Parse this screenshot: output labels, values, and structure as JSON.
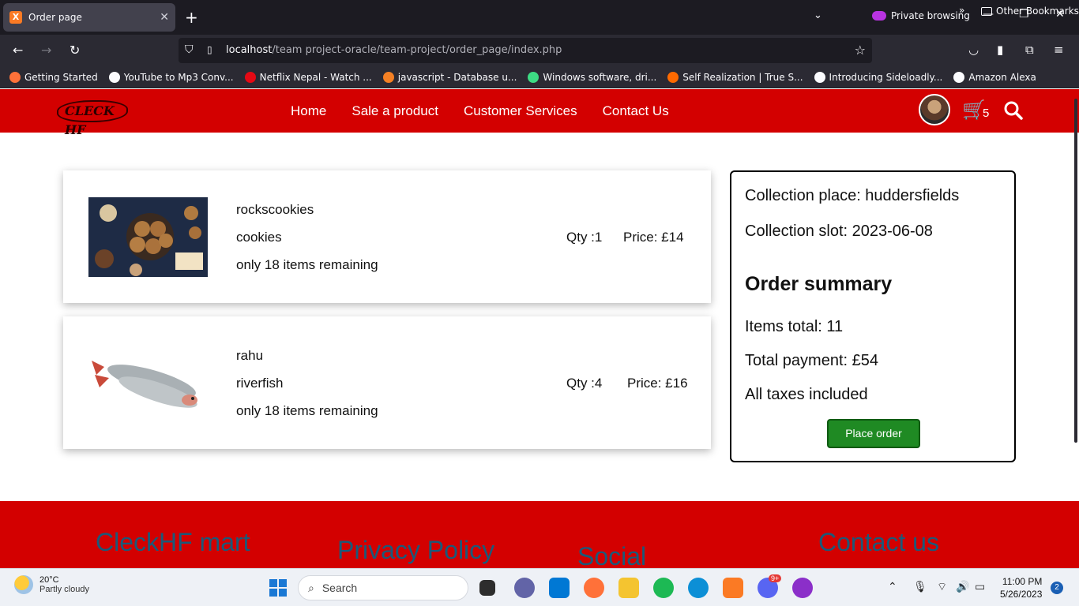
{
  "browser": {
    "tab_title": "Order page",
    "private_label": "Private browsing",
    "url_host": "localhost",
    "url_path": "/team project-oracle/team-project/order_page/index.php",
    "bookmarks": [
      {
        "label": "Getting Started",
        "color": "#ff7139"
      },
      {
        "label": "YouTube to Mp3 Conv...",
        "color": "#fbfbfe"
      },
      {
        "label": "Netflix Nepal - Watch ...",
        "color": "#e50914"
      },
      {
        "label": "javascript - Database u...",
        "color": "#f48024"
      },
      {
        "label": "Windows software, dri...",
        "color": "#3ddc84"
      },
      {
        "label": "Self Realization | True S...",
        "color": "#ff6a00"
      },
      {
        "label": "Introducing Sideloadly...",
        "color": "#fbfbfe"
      },
      {
        "label": "Amazon Alexa",
        "color": "#fbfbfe"
      }
    ],
    "other_bookmarks": "Other Bookmarks"
  },
  "site": {
    "logo_text": "CLECK HF",
    "menu": [
      "Home",
      "Sale a product",
      "Customer Services",
      "Contact Us"
    ],
    "cart_count": "5"
  },
  "cart_items": [
    {
      "name": "rockscookies",
      "category": "cookies",
      "stock": "only 18 items remaining",
      "qty": "Qty :1",
      "price": "Price: £14"
    },
    {
      "name": "rahu",
      "category": "riverfish",
      "stock": "only 18 items remaining",
      "qty": "Qty :4",
      "price": "Price: £16"
    }
  ],
  "summary": {
    "collection_place": "Collection place: huddersfields",
    "collection_slot": "Collection slot: 2023-06-08",
    "heading": "Order summary",
    "items_total": "Items total: 11",
    "total_payment": "Total payment: £54",
    "taxes": "All taxes included",
    "place_order": "Place order"
  },
  "footer": {
    "headings": [
      "CleckHF mart",
      "Privacy Policy",
      "Social",
      "Contact us"
    ]
  },
  "taskbar": {
    "temp": "20°C",
    "weather": "Partly cloudy",
    "search_placeholder": "Search",
    "time": "11:00 PM",
    "date": "5/26/2023",
    "notifications": "2",
    "discord_badge": "9+"
  },
  "colors": {
    "brand_red": "#d30000",
    "button_green": "#1f8a23",
    "footer_heading": "#1a5a7a"
  }
}
